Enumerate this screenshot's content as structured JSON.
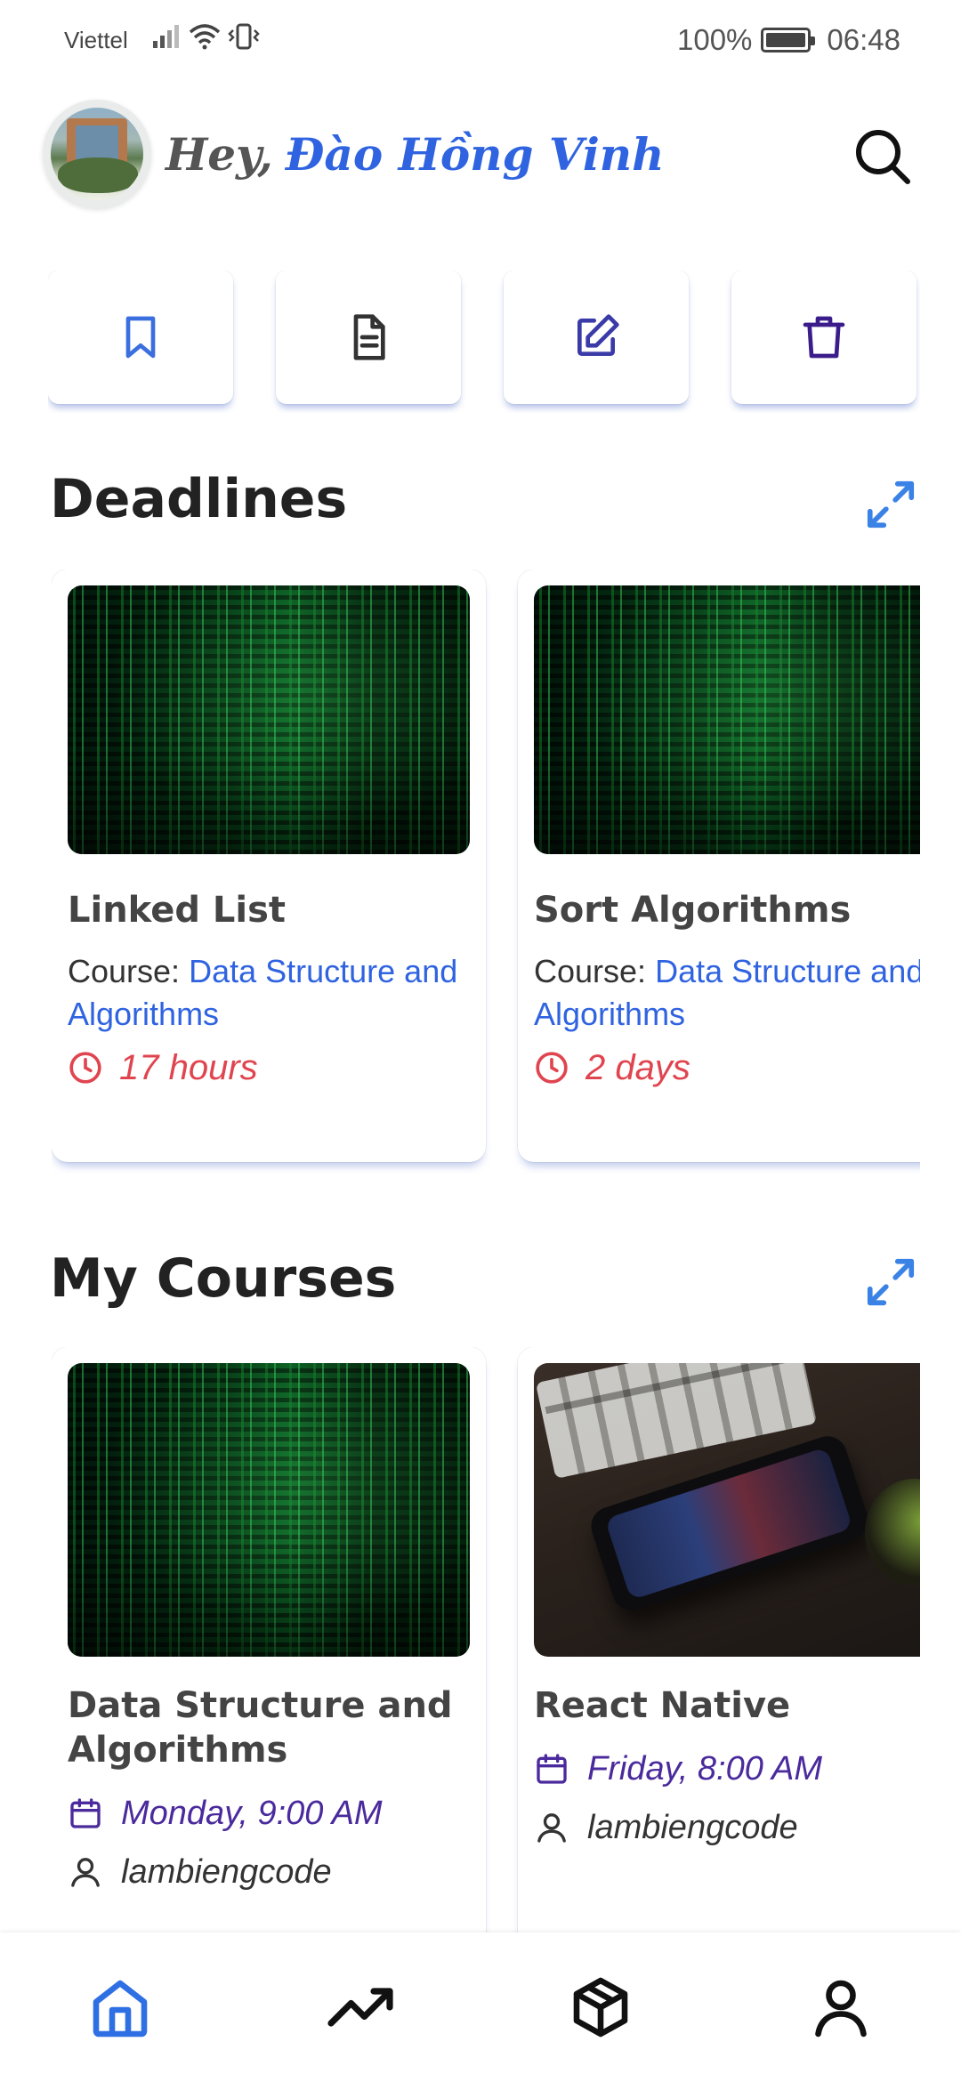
{
  "status_bar": {
    "carrier": "Viettel",
    "battery": "100%",
    "time": "06:48",
    "icons": [
      "signal-icon",
      "wifi-icon",
      "vibrate-icon",
      "battery-icon"
    ]
  },
  "header": {
    "greeting": "Hey,",
    "user_name": "Đào Hồng Vinh",
    "icons": [
      "avatar",
      "search-icon"
    ]
  },
  "quick_actions": [
    {
      "name": "bookmark-icon",
      "color": "#3b6fe0"
    },
    {
      "name": "document-icon",
      "color": "#333333"
    },
    {
      "name": "edit-icon",
      "color": "#3a3aa8"
    },
    {
      "name": "trash-icon",
      "color": "#3a1d8a"
    }
  ],
  "deadlines": {
    "title": "Deadlines",
    "items": [
      {
        "title": "Linked List",
        "course_label": "Course:",
        "course_name": "Data Structure and Algorithms",
        "due": "17 hours",
        "thumbnail": "matrix"
      },
      {
        "title": "Sort Algorithms",
        "course_label": "Course:",
        "course_name": "Data Structure and Algorithms",
        "due": "2 days",
        "thumbnail": "matrix"
      }
    ]
  },
  "my_courses": {
    "title": "My Courses",
    "items": [
      {
        "title": "Data Structure and Algorithms",
        "schedule": "Monday, 9:00 AM",
        "author": "lambiengcode",
        "thumbnail": "matrix"
      },
      {
        "title": "React Native",
        "schedule": "Friday, 8:00 AM",
        "author": "lambiengcode",
        "thumbnail": "phone"
      }
    ]
  },
  "bottom_nav": [
    {
      "name": "home-icon",
      "active": true
    },
    {
      "name": "trending-icon",
      "active": false
    },
    {
      "name": "package-icon",
      "active": false
    },
    {
      "name": "profile-icon",
      "active": false
    }
  ],
  "colors": {
    "accent": "#2f63e0",
    "deadline": "#e0454f",
    "schedule": "#4a2a9c"
  }
}
